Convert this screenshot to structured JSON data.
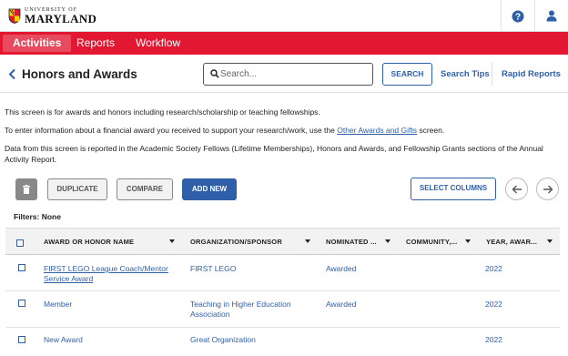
{
  "brand": {
    "logo_top": "UNIVERSITY OF",
    "logo_main": "MARYLAND",
    "accent": "#e21833",
    "link_color": "#2f5fa8"
  },
  "topbar": {
    "help_icon": "help-circle-icon",
    "user_icon": "user-icon"
  },
  "nav": {
    "items": [
      {
        "label": "Activities",
        "active": true
      },
      {
        "label": "Reports",
        "active": false
      },
      {
        "label": "Workflow",
        "active": false
      }
    ]
  },
  "header": {
    "title": "Honors and Awards",
    "search_placeholder": "Search...",
    "search_value": "",
    "search_button": "SEARCH",
    "search_tips": "Search Tips",
    "rapid_reports": "Rapid Reports"
  },
  "intro": {
    "line1": "This screen is for awards and honors including research/scholarship or teaching fellowships.",
    "line2_pre": "To enter information about a financial award you received to support your research/work, use the ",
    "line2_link": "Other Awards and Gifts",
    "line2_post": " screen.",
    "line3a": "Data from this screen is reported in the Academic Society Fellows (Lifetime Memberships), Honors and Awards, and Fellowship Grants sections of the Annual",
    "line3b": "Activity Report."
  },
  "toolbar": {
    "delete_icon": "trash-icon",
    "duplicate": "DUPLICATE",
    "compare": "COMPARE",
    "add_new": "ADD NEW",
    "select_columns": "SELECT COLUMNS",
    "prev_icon": "arrow-left-icon",
    "next_icon": "arrow-right-icon"
  },
  "filters": "Filters: None",
  "table": {
    "columns": [
      "AWARD OR HONOR NAME",
      "ORGANIZATION/SPONSOR",
      "NOMINATED ...",
      "COMMUNITY,...",
      "YEAR, AWAR..."
    ],
    "rows": [
      {
        "name_l1": "FIRST LEGO League Coach/Mentor",
        "name_l2": "Service Award",
        "org_l1": "FIRST LEGO",
        "org_l2": "",
        "nominated": "Awarded",
        "community": "",
        "year": "2022"
      },
      {
        "name_l1": "Member",
        "name_l2": "",
        "org_l1": "Teaching in Higher Education",
        "org_l2": "Association",
        "nominated": "Awarded",
        "community": "",
        "year": "2022"
      },
      {
        "name_l1": "New Award",
        "name_l2": "",
        "org_l1": "Great Organization",
        "org_l2": "",
        "nominated": "",
        "community": "",
        "year": "2022"
      }
    ]
  }
}
